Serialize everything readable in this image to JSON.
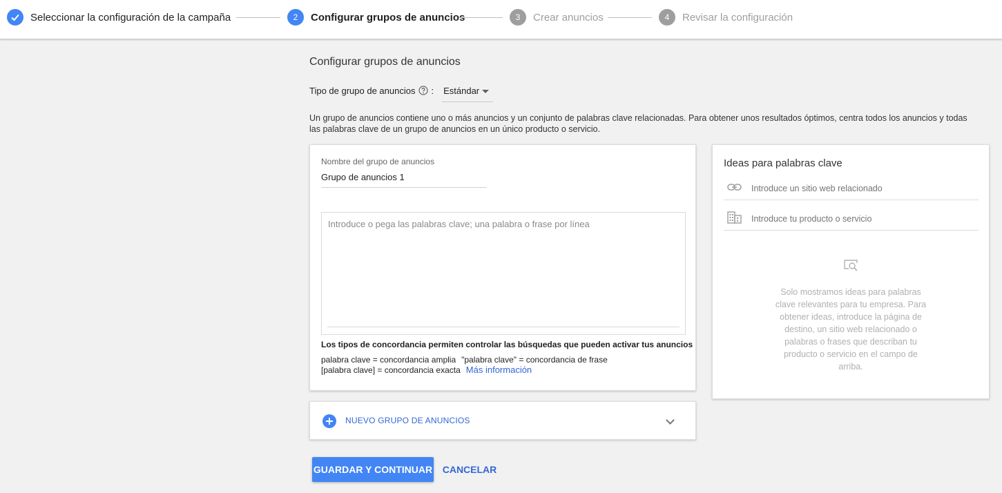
{
  "stepper": {
    "steps": [
      {
        "number": "",
        "label": "Seleccionar la configuración de la campaña",
        "state": "done"
      },
      {
        "number": "2",
        "label": "Configurar grupos de anuncios",
        "state": "active"
      },
      {
        "number": "3",
        "label": "Crear anuncios",
        "state": "todo"
      },
      {
        "number": "4",
        "label": "Revisar la configuración",
        "state": "todo"
      }
    ]
  },
  "page": {
    "title": "Configurar grupos de anuncios",
    "type_label": "Tipo de grupo de anuncios",
    "type_colon": ":",
    "type_value": "Estándar",
    "description": "Un grupo de anuncios contiene uno o más anuncios y un conjunto de palabras clave relacionadas. Para obtener unos resultados óptimos, centra todos los anuncios y todas las palabras clave de un grupo de anuncios en un único producto o servicio."
  },
  "ad_group": {
    "name_label": "Nombre del grupo de anuncios",
    "name_value": "Grupo de anuncios 1",
    "keywords_placeholder": "Introduce o pega las palabras clave; una palabra o frase por línea",
    "match_title": "Los tipos de concordancia permiten controlar las búsquedas que pueden activar tus anuncios",
    "match_broad": "palabra clave = concordancia amplia",
    "match_phrase": "\"palabra clave\" = concordancia de frase",
    "match_exact": "[palabra clave] = concordancia exacta",
    "more_info": "Más información"
  },
  "new_group": {
    "label": "NUEVO GRUPO DE ANUNCIOS"
  },
  "ideas": {
    "title": "Ideas para palabras clave",
    "website_placeholder": "Introduce un sitio web relacionado",
    "product_placeholder": "Introduce tu producto o servicio",
    "empty_text": "Solo mostramos ideas para palabras clave relevantes para tu empresa. Para obtener ideas, introduce la página de destino, un sitio web relacionado o palabras o frases que describan tu producto o servicio en el campo de arriba."
  },
  "actions": {
    "save": "GUARDAR Y CONTINUAR",
    "cancel": "CANCELAR"
  },
  "colors": {
    "accent": "#4285f4",
    "link": "#3367d6",
    "inactive": "#9e9e9e"
  }
}
